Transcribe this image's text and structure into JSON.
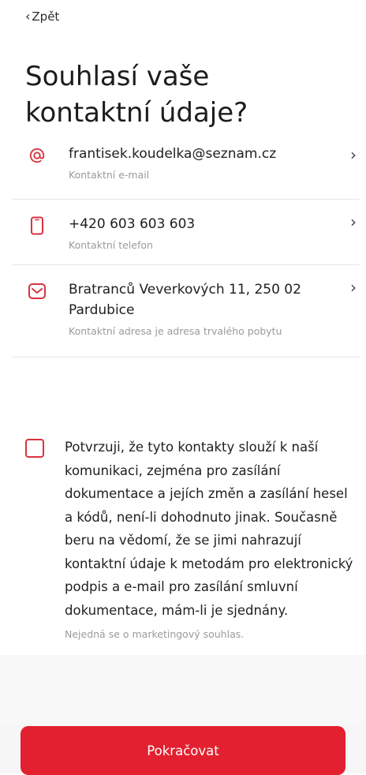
{
  "nav": {
    "back_label": "Zpět"
  },
  "title": "Souhlasí vaše kontaktní údaje?",
  "contacts": [
    {
      "icon": "at-icon",
      "value": "frantisek.koudelka@seznam.cz",
      "label": "Kontaktní e-mail"
    },
    {
      "icon": "phone-icon",
      "value": "+420 603 603 603",
      "label": "Kontaktní telefon"
    },
    {
      "icon": "mail-icon",
      "value": "Bratranců Veverkových 11, 250 02 Pardubice",
      "label": "Kontaktní adresa je adresa trvalého pobytu"
    }
  ],
  "consent": {
    "text": "Potvrzuji, že tyto kontakty slouží k naší komunikaci, zejména pro zasílání dokumentace a jejích změn a zasílání hesel a kódů, není-li dohodnuto jinak. Současně beru na vědomí, že se jimi nahrazují kontaktní údaje k metodám pro elektronický podpis a e-mail pro zasílání smluvní dokumentace, mám-li je sjednány.",
    "note": "Nejedná se o marketingový souhlas.",
    "checked": false
  },
  "actions": {
    "continue_label": "Pokračovat"
  },
  "colors": {
    "accent": "#e3202f",
    "muted_text": "#9a9a9a",
    "divider": "#e7e7e7"
  }
}
